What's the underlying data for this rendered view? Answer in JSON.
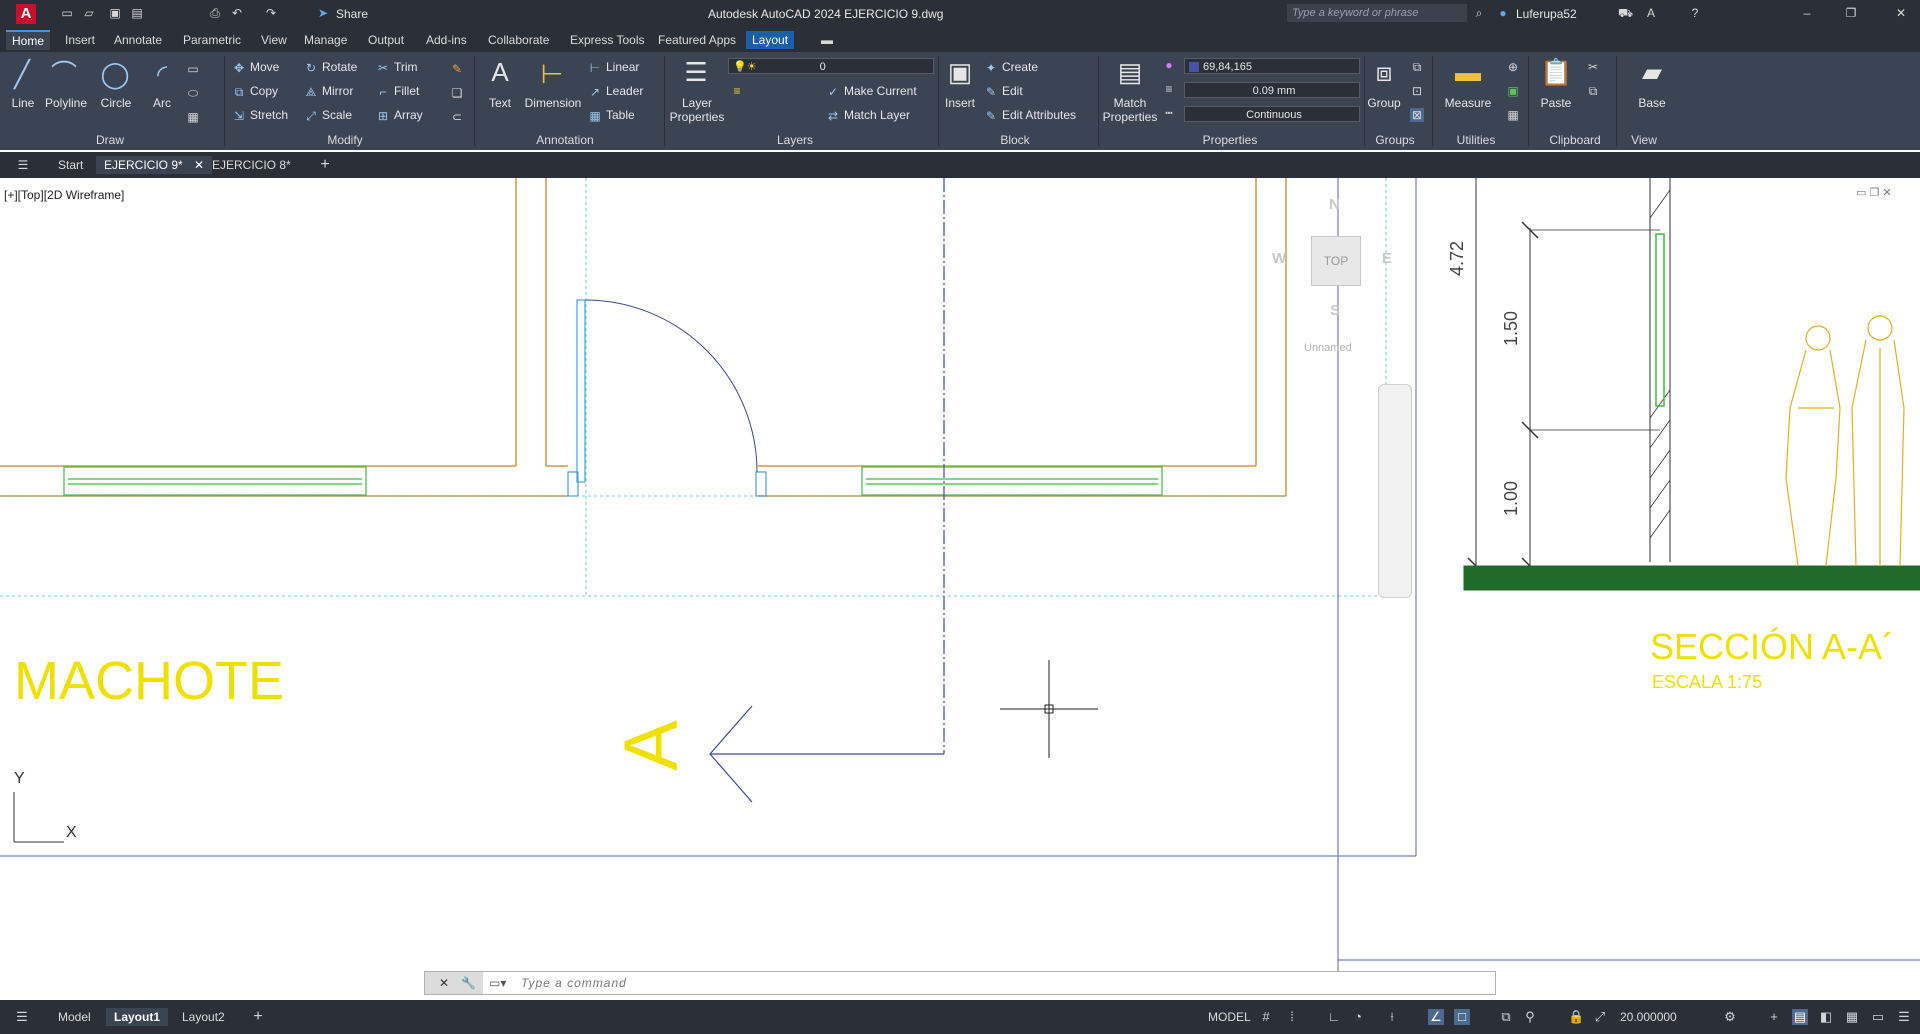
{
  "app": {
    "logo_letter": "A",
    "title": "Autodesk AutoCAD 2024    EJERCICIO 9.dwg",
    "share_label": "Share",
    "search_placeholder": "Type a keyword or phrase",
    "user": "Luferupa52"
  },
  "ribbon_tabs": [
    "Home",
    "Insert",
    "Annotate",
    "Parametric",
    "View",
    "Manage",
    "Output",
    "Add-ins",
    "Collaborate",
    "Express Tools",
    "Featured Apps",
    "Layout"
  ],
  "ribbon": {
    "draw": {
      "title": "Draw",
      "line": "Line",
      "polyline": "Polyline",
      "circle": "Circle",
      "arc": "Arc"
    },
    "modify": {
      "title": "Modify",
      "move": "Move",
      "rotate": "Rotate",
      "trim": "Trim",
      "copy": "Copy",
      "mirror": "Mirror",
      "fillet": "Fillet",
      "stretch": "Stretch",
      "scale": "Scale",
      "array": "Array"
    },
    "annotation": {
      "title": "Annotation",
      "text": "Text",
      "dimension": "Dimension",
      "linear": "Linear",
      "leader": "Leader",
      "table": "Table"
    },
    "layers": {
      "title": "Layers",
      "layer_properties": "Layer Properties",
      "current_layer": "0",
      "make_current": "Make Current",
      "match_layer": "Match Layer"
    },
    "block": {
      "title": "Block",
      "insert": "Insert",
      "create": "Create",
      "edit": "Edit",
      "edit_attributes": "Edit Attributes"
    },
    "properties": {
      "title": "Properties",
      "match_properties": "Match Properties",
      "color": "69,84,165",
      "lineweight": "0.09 mm",
      "linetype": "Continuous"
    },
    "groups": {
      "title": "Groups",
      "group": "Group"
    },
    "utilities": {
      "title": "Utilities",
      "measure": "Measure"
    },
    "clipboard": {
      "title": "Clipboard",
      "paste": "Paste"
    },
    "view": {
      "title": "View",
      "base": "Base"
    }
  },
  "doc_tabs": {
    "start": "Start",
    "tab1": "EJERCICIO 9*",
    "tab2": "EJERCICIO 8*"
  },
  "viewport": {
    "label": "[+][Top][2D Wireframe]"
  },
  "viewcube": {
    "top": "TOP",
    "north": "N",
    "south": "S",
    "east": "E",
    "west": "W",
    "ucs_name": "Unnamed"
  },
  "drawing": {
    "title_left": "MACHOTE",
    "section_letter": "A",
    "section_title": "SECCIÓN A-A´",
    "section_scale": "ESCALA 1:75",
    "dim_total": "4.72",
    "dim_mid": "1.50",
    "dim_low": "1.00",
    "ucs_y": "Y",
    "ucs_x": "X"
  },
  "command": {
    "placeholder": "Type  a  command"
  },
  "status": {
    "model_tab": "Model",
    "layout1": "Layout1",
    "layout2": "Layout2",
    "model_label": "MODEL",
    "scale": "20.000000"
  },
  "colors": {
    "accent": "#1a5fa8",
    "wall": "#d9953a",
    "window": "#3cbf3c",
    "door": "#4a9fd8",
    "section_text": "#f0e000",
    "ground": "#1f6b2a"
  }
}
